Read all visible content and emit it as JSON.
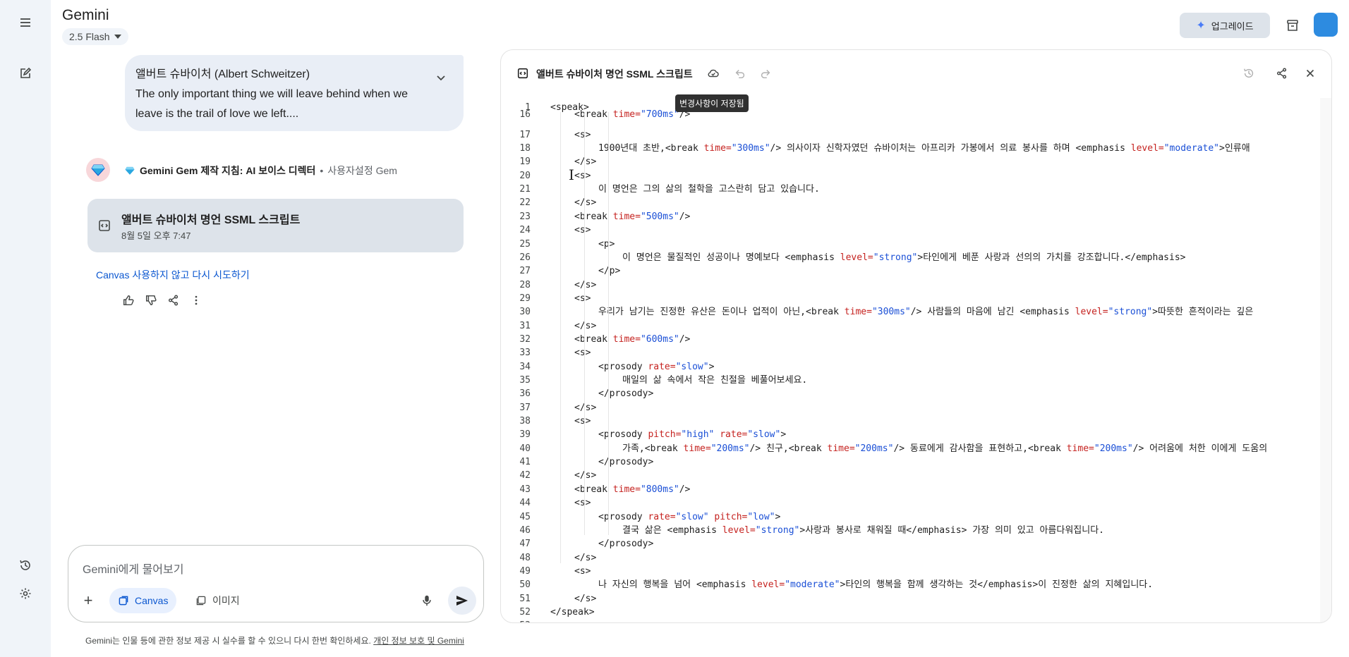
{
  "app": {
    "title": "Gemini",
    "model": "2.5 Flash",
    "upgrade_label": "업그레이드"
  },
  "user_message": {
    "name": "앨버트 슈바이처 (Albert Schweitzer)",
    "text": "The only important thing we will leave behind when we leave is the trail of love we left...."
  },
  "gem": {
    "name": "Gemini Gem 제작 지침: AI 보이스 디렉터",
    "separator": "•",
    "subtitle": "사용자설정 Gem"
  },
  "canvas_card": {
    "title": "앨버트 슈바이처 명언 SSML 스크립트",
    "date": "8월 5일 오후 7:47"
  },
  "retry_link": "Canvas 사용하지 않고 다시 시도하기",
  "input": {
    "placeholder": "Gemini에게 물어보기",
    "canvas_chip": "Canvas",
    "image_chip": "이미지"
  },
  "disclaimer": {
    "text": "Gemini는 인물 등에 관한 정보 제공 시 실수를 할 수 있으니 다시 한번 확인하세요.",
    "link": "개인 정보 보호 및 Gemini"
  },
  "editor": {
    "title": "앨버트 슈바이처 명언 SSML 스크립트",
    "tooltip": "변경사항이 저장됨",
    "lines": [
      {
        "n": "1",
        "indent": 0,
        "parts": [
          [
            "t",
            "<speak>"
          ]
        ]
      },
      {
        "n": "16",
        "indent": 1,
        "parts": [
          [
            "t",
            "<break "
          ],
          [
            "a",
            "time="
          ],
          [
            "v",
            "\"700ms\""
          ],
          [
            "t",
            "/>"
          ]
        ]
      },
      {
        "n": "17",
        "indent": 1,
        "parts": [
          [
            "t",
            "<s>"
          ]
        ]
      },
      {
        "n": "18",
        "indent": 2,
        "parts": [
          [
            "x",
            "1900년대 초반,"
          ],
          [
            "t",
            "<break "
          ],
          [
            "a",
            "time="
          ],
          [
            "v",
            "\"300ms\""
          ],
          [
            "t",
            "/>"
          ],
          [
            "x",
            " 의사이자 신학자였던 슈바이처는 아프리카 가봉에서 의료 봉사를 하며 "
          ],
          [
            "t",
            "<emphasis "
          ],
          [
            "a",
            "level="
          ],
          [
            "v",
            "\"moderate\""
          ],
          [
            "t",
            ">"
          ],
          [
            "x",
            "인류애"
          ]
        ]
      },
      {
        "n": "19",
        "indent": 1,
        "parts": [
          [
            "t",
            "</s>"
          ]
        ]
      },
      {
        "n": "20",
        "indent": 1,
        "parts": [
          [
            "t",
            "<s>"
          ]
        ]
      },
      {
        "n": "21",
        "indent": 2,
        "parts": [
          [
            "x",
            "이 명언은 그의 삶의 철학을 고스란히 담고 있습니다."
          ]
        ]
      },
      {
        "n": "22",
        "indent": 1,
        "parts": [
          [
            "t",
            "</s>"
          ]
        ]
      },
      {
        "n": "23",
        "indent": 1,
        "parts": [
          [
            "t",
            "<break "
          ],
          [
            "a",
            "time="
          ],
          [
            "v",
            "\"500ms\""
          ],
          [
            "t",
            "/>"
          ]
        ]
      },
      {
        "n": "24",
        "indent": 1,
        "parts": [
          [
            "t",
            "<s>"
          ]
        ]
      },
      {
        "n": "25",
        "indent": 2,
        "parts": [
          [
            "t",
            "<p>"
          ]
        ]
      },
      {
        "n": "26",
        "indent": 3,
        "parts": [
          [
            "x",
            "이 명언은 물질적인 성공이나 명예보다 "
          ],
          [
            "t",
            "<emphasis "
          ],
          [
            "a",
            "level="
          ],
          [
            "v",
            "\"strong\""
          ],
          [
            "t",
            ">"
          ],
          [
            "x",
            "타인에게 베푼 사랑과 선의의 가치를 강조합니다."
          ],
          [
            "t",
            "</emphasis>"
          ]
        ]
      },
      {
        "n": "27",
        "indent": 2,
        "parts": [
          [
            "t",
            "</p>"
          ]
        ]
      },
      {
        "n": "28",
        "indent": 1,
        "parts": [
          [
            "t",
            "</s>"
          ]
        ]
      },
      {
        "n": "29",
        "indent": 1,
        "parts": [
          [
            "t",
            "<s>"
          ]
        ]
      },
      {
        "n": "30",
        "indent": 2,
        "parts": [
          [
            "x",
            "우리가 남기는 진정한 유산은 돈이나 업적이 아닌,"
          ],
          [
            "t",
            "<break "
          ],
          [
            "a",
            "time="
          ],
          [
            "v",
            "\"300ms\""
          ],
          [
            "t",
            "/>"
          ],
          [
            "x",
            " 사람들의 마음에 남긴 "
          ],
          [
            "t",
            "<emphasis "
          ],
          [
            "a",
            "level="
          ],
          [
            "v",
            "\"strong\""
          ],
          [
            "t",
            ">"
          ],
          [
            "x",
            "따뜻한 흔적이라는 깊은"
          ]
        ]
      },
      {
        "n": "31",
        "indent": 1,
        "parts": [
          [
            "t",
            "</s>"
          ]
        ]
      },
      {
        "n": "32",
        "indent": 1,
        "parts": [
          [
            "t",
            "<break "
          ],
          [
            "a",
            "time="
          ],
          [
            "v",
            "\"600ms\""
          ],
          [
            "t",
            "/>"
          ]
        ]
      },
      {
        "n": "33",
        "indent": 1,
        "parts": [
          [
            "t",
            "<s>"
          ]
        ]
      },
      {
        "n": "34",
        "indent": 2,
        "parts": [
          [
            "t",
            "<prosody "
          ],
          [
            "a",
            "rate="
          ],
          [
            "v",
            "\"slow\""
          ],
          [
            "t",
            ">"
          ]
        ]
      },
      {
        "n": "35",
        "indent": 3,
        "parts": [
          [
            "x",
            "매일의 삶 속에서 작은 친절을 베풀어보세요."
          ]
        ]
      },
      {
        "n": "36",
        "indent": 2,
        "parts": [
          [
            "t",
            "</prosody>"
          ]
        ]
      },
      {
        "n": "37",
        "indent": 1,
        "parts": [
          [
            "t",
            "</s>"
          ]
        ]
      },
      {
        "n": "38",
        "indent": 1,
        "parts": [
          [
            "t",
            "<s>"
          ]
        ]
      },
      {
        "n": "39",
        "indent": 2,
        "parts": [
          [
            "t",
            "<prosody "
          ],
          [
            "a",
            "pitch="
          ],
          [
            "v",
            "\"high\""
          ],
          [
            "t",
            " "
          ],
          [
            "a",
            "rate="
          ],
          [
            "v",
            "\"slow\""
          ],
          [
            "t",
            ">"
          ]
        ]
      },
      {
        "n": "40",
        "indent": 3,
        "parts": [
          [
            "x",
            "가족,"
          ],
          [
            "t",
            "<break "
          ],
          [
            "a",
            "time="
          ],
          [
            "v",
            "\"200ms\""
          ],
          [
            "t",
            "/>"
          ],
          [
            "x",
            " 친구,"
          ],
          [
            "t",
            "<break "
          ],
          [
            "a",
            "time="
          ],
          [
            "v",
            "\"200ms\""
          ],
          [
            "t",
            "/>"
          ],
          [
            "x",
            " 동료에게 감사함을 표현하고,"
          ],
          [
            "t",
            "<break "
          ],
          [
            "a",
            "time="
          ],
          [
            "v",
            "\"200ms\""
          ],
          [
            "t",
            "/>"
          ],
          [
            "x",
            " 어려움에 처한 이에게 도움의"
          ]
        ]
      },
      {
        "n": "41",
        "indent": 2,
        "parts": [
          [
            "t",
            "</prosody>"
          ]
        ]
      },
      {
        "n": "42",
        "indent": 1,
        "parts": [
          [
            "t",
            "</s>"
          ]
        ]
      },
      {
        "n": "43",
        "indent": 1,
        "parts": [
          [
            "t",
            "<break "
          ],
          [
            "a",
            "time="
          ],
          [
            "v",
            "\"800ms\""
          ],
          [
            "t",
            "/>"
          ]
        ]
      },
      {
        "n": "44",
        "indent": 1,
        "parts": [
          [
            "t",
            "<s>"
          ]
        ]
      },
      {
        "n": "45",
        "indent": 2,
        "parts": [
          [
            "t",
            "<prosody "
          ],
          [
            "a",
            "rate="
          ],
          [
            "v",
            "\"slow\""
          ],
          [
            "t",
            " "
          ],
          [
            "a",
            "pitch="
          ],
          [
            "v",
            "\"low\""
          ],
          [
            "t",
            ">"
          ]
        ]
      },
      {
        "n": "46",
        "indent": 3,
        "parts": [
          [
            "x",
            "결국 삶은 "
          ],
          [
            "t",
            "<emphasis "
          ],
          [
            "a",
            "level="
          ],
          [
            "v",
            "\"strong\""
          ],
          [
            "t",
            ">"
          ],
          [
            "x",
            "사랑과 봉사로 채워질 때"
          ],
          [
            "t",
            "</emphasis>"
          ],
          [
            "x",
            " 가장 의미 있고 아름다워집니다."
          ]
        ]
      },
      {
        "n": "47",
        "indent": 2,
        "parts": [
          [
            "t",
            "</prosody>"
          ]
        ]
      },
      {
        "n": "48",
        "indent": 1,
        "parts": [
          [
            "t",
            "</s>"
          ]
        ]
      },
      {
        "n": "49",
        "indent": 1,
        "parts": [
          [
            "t",
            "<s>"
          ]
        ]
      },
      {
        "n": "50",
        "indent": 2,
        "parts": [
          [
            "x",
            "나 자신의 행복을 넘어 "
          ],
          [
            "t",
            "<emphasis "
          ],
          [
            "a",
            "level="
          ],
          [
            "v",
            "\"moderate\""
          ],
          [
            "t",
            ">"
          ],
          [
            "x",
            "타인의 행복을 함께 생각하는 것"
          ],
          [
            "t",
            "</emphasis>"
          ],
          [
            "x",
            "이 진정한 삶의 지혜입니다."
          ]
        ]
      },
      {
        "n": "51",
        "indent": 1,
        "parts": [
          [
            "t",
            "</s>"
          ]
        ]
      },
      {
        "n": "52",
        "indent": 0,
        "parts": [
          [
            "t",
            "</speak>"
          ]
        ]
      },
      {
        "n": "53",
        "indent": 0,
        "parts": []
      }
    ]
  },
  "colors": {
    "accent": "#0b57d0",
    "xml_attr": "#c5221f",
    "xml_value": "#1a4fd6",
    "rail_bg": "#f0f4f9"
  }
}
